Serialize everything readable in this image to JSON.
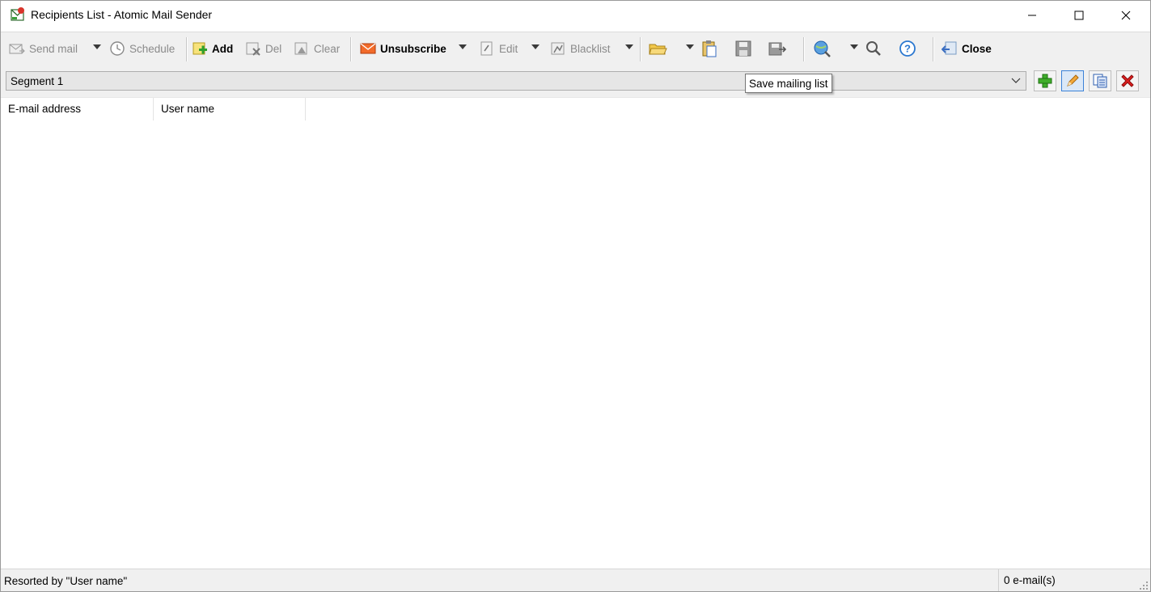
{
  "window": {
    "title": "Recipients List - Atomic Mail Sender",
    "controls": [
      "minimize",
      "maximize",
      "close"
    ]
  },
  "toolbar": {
    "send_mail": "Send mail",
    "schedule": "Schedule",
    "add": "Add",
    "del": "Del",
    "clear": "Clear",
    "unsubscribe": "Unsubscribe",
    "edit": "Edit",
    "blacklist": "Blacklist",
    "close": "Close",
    "icons": [
      "send-mail-icon",
      "clock-icon",
      "add-icon",
      "delete-icon",
      "clear-icon",
      "unsubscribe-icon",
      "edit-icon",
      "blacklist-icon",
      "open-folder-icon",
      "paste-icon",
      "save-icon",
      "save-as-icon",
      "search-globe-icon",
      "find-icon",
      "help-icon",
      "close-icon"
    ]
  },
  "segment": {
    "selected": "Segment 1",
    "buttons": [
      "add-segment",
      "edit-segment",
      "copy-segment",
      "delete-segment"
    ]
  },
  "tooltip": {
    "text": "Save mailing list"
  },
  "table": {
    "columns": [
      "E-mail address",
      "User name"
    ],
    "rows": []
  },
  "status": {
    "sort": "Resorted by \"User name\"",
    "count": "0 e-mail(s)"
  },
  "colors": {
    "toolbar_bg": "#f0f0f0",
    "active_border": "#3b82d8",
    "disabled_text": "#8a8a8a"
  }
}
